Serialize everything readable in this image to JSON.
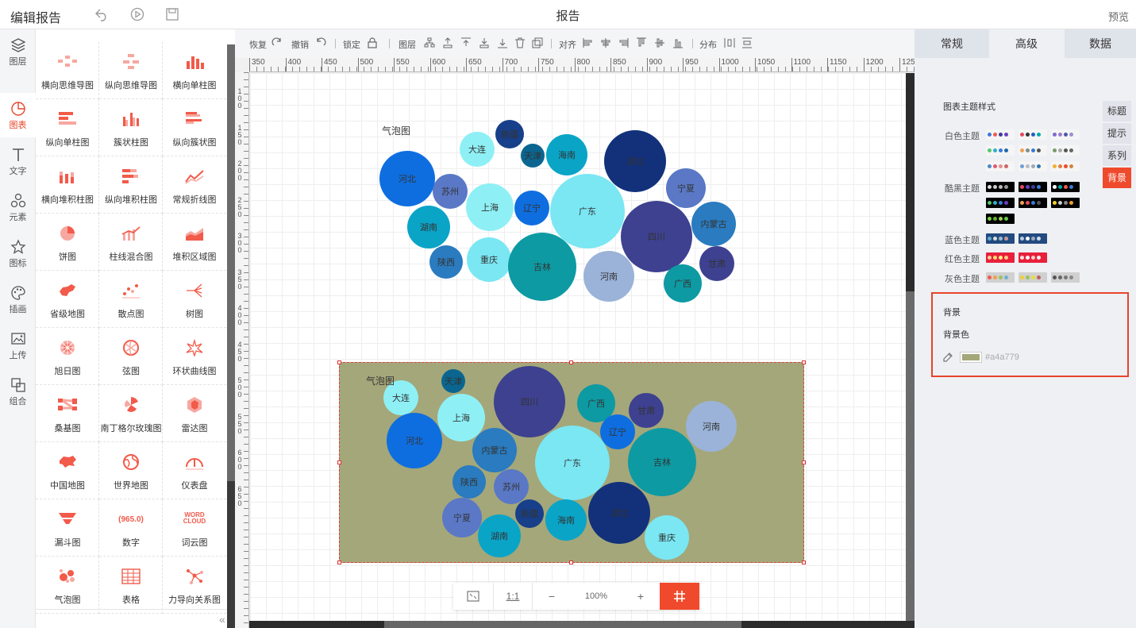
{
  "app": {
    "title": "编辑报告",
    "report_title": "报告",
    "preview_label": "预览"
  },
  "rail": [
    {
      "label": "图层",
      "icon": "layers-icon"
    },
    {
      "label": "图表",
      "icon": "chart-icon",
      "active": true
    },
    {
      "label": "文字",
      "icon": "text-icon"
    },
    {
      "label": "元素",
      "icon": "shapes-icon"
    },
    {
      "label": "图标",
      "icon": "star-icon"
    },
    {
      "label": "插画",
      "icon": "palette-icon"
    },
    {
      "label": "上传",
      "icon": "upload-image-icon"
    },
    {
      "label": "组合",
      "icon": "group-icon"
    }
  ],
  "components": [
    "横向思维导图",
    "纵向思维导图",
    "横向单柱图",
    "纵向单柱图",
    "簇状柱图",
    "纵向簇状图",
    "横向堆积柱图",
    "纵向堆积柱图",
    "常规折线图",
    "饼图",
    "柱线混合图",
    "堆积区域图",
    "省级地图",
    "散点图",
    "树图",
    "旭日图",
    "弦图",
    "环状曲线图",
    "桑基图",
    "南丁格尔玫瑰图",
    "雷达图",
    "中国地图",
    "世界地图",
    "仪表盘",
    "漏斗图",
    "数字",
    "词云图",
    "气泡图",
    "表格",
    "力导向关系图"
  ],
  "number_icon_text": "(965.0)",
  "wordcloud_icon_text": [
    "WORD",
    "CLOUD"
  ],
  "toolbar": {
    "redo": "恢复",
    "undo": "撤销",
    "lock": "锁定",
    "layer": "图层",
    "align": "对齐",
    "distribute": "分布"
  },
  "ruler_marks": [
    "350",
    "400",
    "450",
    "500",
    "550",
    "600",
    "650",
    "700",
    "750",
    "800",
    "850",
    "900",
    "950",
    "1000",
    "1050",
    "1100",
    "1150",
    "1200",
    "1250"
  ],
  "ruler_v_marks": [
    "100",
    "150",
    "200",
    "250",
    "300",
    "350",
    "400",
    "450",
    "500",
    "550",
    "600",
    "650"
  ],
  "zoom": {
    "fit_label": "",
    "one_to_one": "1:1",
    "minus": "−",
    "level": "100%",
    "plus": "+"
  },
  "chart_data": [
    {
      "type": "bubble",
      "title": "气泡图",
      "background": "#ffffff",
      "points": [
        {
          "name": "大连",
          "value": 22
        },
        {
          "name": "新疆",
          "value": 18
        },
        {
          "name": "天津",
          "value": 15
        },
        {
          "name": "海南",
          "value": 26
        },
        {
          "name": "湖北",
          "value": 39
        },
        {
          "name": "河北",
          "value": 35
        },
        {
          "name": "苏州",
          "value": 22
        },
        {
          "name": "上海",
          "value": 30
        },
        {
          "name": "辽宁",
          "value": 22
        },
        {
          "name": "广东",
          "value": 47
        },
        {
          "name": "宁夏",
          "value": 25
        },
        {
          "name": "内蒙古",
          "value": 28
        },
        {
          "name": "湖南",
          "value": 27
        },
        {
          "name": "四川",
          "value": 45
        },
        {
          "name": "陕西",
          "value": 21
        },
        {
          "name": "重庆",
          "value": 28
        },
        {
          "name": "吉林",
          "value": 43
        },
        {
          "name": "河南",
          "value": 32
        },
        {
          "name": "甘肃",
          "value": 22
        },
        {
          "name": "广西",
          "value": 24
        }
      ]
    },
    {
      "type": "bubble",
      "title": "气泡图",
      "background": "#a4a779",
      "selected": true,
      "points": [
        {
          "name": "大连",
          "value": 22
        },
        {
          "name": "天津",
          "value": 15
        },
        {
          "name": "四川",
          "value": 45
        },
        {
          "name": "广西",
          "value": 24
        },
        {
          "name": "甘肃",
          "value": 22
        },
        {
          "name": "河南",
          "value": 32
        },
        {
          "name": "上海",
          "value": 30
        },
        {
          "name": "河北",
          "value": 35
        },
        {
          "name": "辽宁",
          "value": 22
        },
        {
          "name": "内蒙古",
          "value": 28
        },
        {
          "name": "广东",
          "value": 47
        },
        {
          "name": "吉林",
          "value": 43
        },
        {
          "name": "陕西",
          "value": 21
        },
        {
          "name": "苏州",
          "value": 22
        },
        {
          "name": "宁夏",
          "value": 25
        },
        {
          "name": "新疆",
          "value": 18
        },
        {
          "name": "海南",
          "value": 26
        },
        {
          "name": "湖北",
          "value": 39
        },
        {
          "name": "湖南",
          "value": 27
        },
        {
          "name": "重庆",
          "value": 28
        }
      ]
    }
  ],
  "palette": [
    "#0e6ee0",
    "#5677c9",
    "#7ae7f3",
    "#0aa4c7",
    "#0d9aa3",
    "#1e3a8a",
    "#2a7bbf",
    "#9bb3d8",
    "#3d3e8f",
    "#12317a"
  ],
  "bubble_colors": {
    "大连": "#8ef0f5",
    "新疆": "#173f8a",
    "天津": "#0a6690",
    "海南": "#0aa4c7",
    "湖北": "#12317a",
    "河北": "#0e6ee0",
    "苏州": "#5a78c6",
    "上海": "#8ef0f5",
    "辽宁": "#0e6ee0",
    "广东": "#7ae7f3",
    "宁夏": "#5a78c6",
    "内蒙古": "#2a7bbf",
    "湖南": "#0aa4c7",
    "四川": "#3d418f",
    "陕西": "#2a7bbf",
    "重庆": "#7ae7f3",
    "吉林": "#0d9aa3",
    "河南": "#9bb3d8",
    "甘肃": "#3d418f",
    "广西": "#0d9aa3"
  },
  "right_panel": {
    "tabs": [
      "常规",
      "高级",
      "数据"
    ],
    "active_tab": 1,
    "theme_section": "图表主题样式",
    "themes": [
      {
        "label": "白色主题",
        "rows": 3
      },
      {
        "label": "酷黑主题",
        "rows": 3
      },
      {
        "label": "蓝色主题",
        "rows": 1
      },
      {
        "label": "红色主题",
        "rows": 1
      },
      {
        "label": "灰色主题",
        "rows": 1
      }
    ],
    "side_tabs": [
      "标题",
      "提示",
      "系列",
      "背景"
    ],
    "bg_section": "背景",
    "bg_color_label": "背景色",
    "bg_color_value": "#a4a779"
  }
}
